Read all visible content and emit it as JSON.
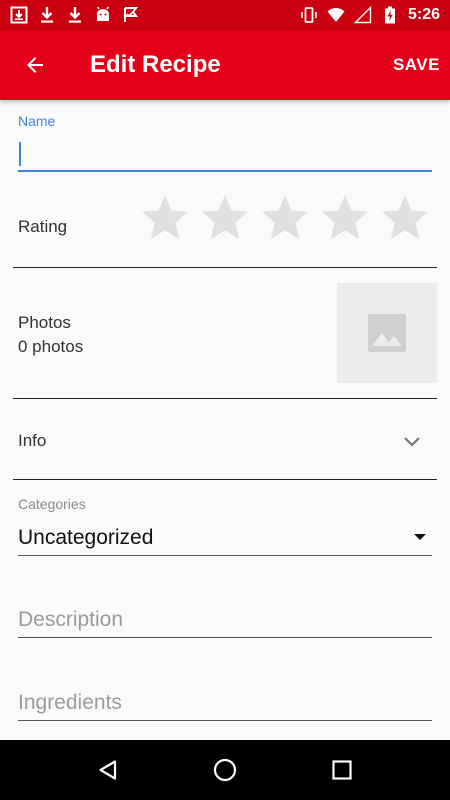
{
  "status_bar": {
    "time": "5:26",
    "left_icons": [
      "download-box-icon",
      "download-icon",
      "download-icon",
      "android-icon",
      "check-flag-icon"
    ],
    "right_icons": [
      "vibrate-icon",
      "wifi-icon",
      "cell-signal-icon",
      "battery-charging-icon"
    ]
  },
  "app_bar": {
    "title": "Edit Recipe",
    "save_label": "SAVE",
    "back_icon": "arrow-left-icon"
  },
  "form": {
    "name_label": "Name",
    "name_value": "",
    "rating_label": "Rating",
    "rating_value": 0,
    "rating_max": 5,
    "photos_label": "Photos",
    "photos_count": "0 photos",
    "info_label": "Info",
    "categories_label": "Categories",
    "categories_value": "Uncategorized",
    "description_placeholder": "Description",
    "ingredients_placeholder": "Ingredients"
  },
  "colors": {
    "status_bar": "#c8000f",
    "app_bar": "#e50019",
    "accent": "#3f86d6",
    "star_empty": "#e0e0e0"
  },
  "nav_bar": {
    "icons": [
      "back-triangle-icon",
      "home-circle-icon",
      "recents-square-icon"
    ]
  }
}
